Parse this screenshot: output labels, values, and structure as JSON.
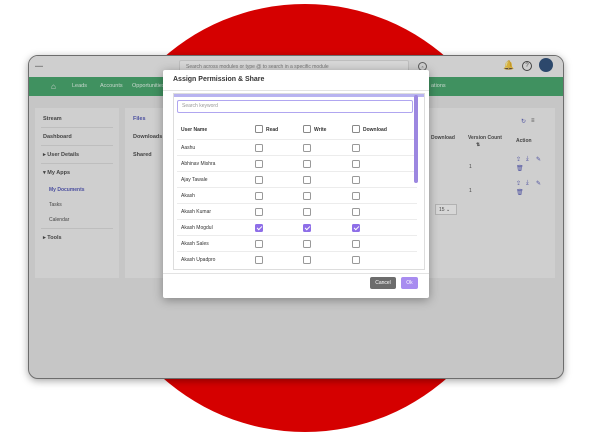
{
  "topbar": {
    "search_placeholder": "Search across modules or type @ to search in a specific module"
  },
  "nav": {
    "links": [
      "Leads",
      "Accounts",
      "Opportunities",
      "ations"
    ]
  },
  "sidebar": {
    "items": [
      "Stream",
      "Dashboard",
      "User Details",
      "My Apps",
      "My Documents",
      "Tasks",
      "Calendar",
      "Tools"
    ]
  },
  "folders": [
    "Files",
    "Downloads",
    "Shared"
  ],
  "main": {
    "headers": [
      "Download",
      "Version Count",
      "Action"
    ],
    "version_counts": [
      "1",
      "1"
    ],
    "page_size": "15"
  },
  "modal": {
    "title": "Assign Permission & Share",
    "search_placeholder": "Search keyword",
    "columns": {
      "user": "User Name",
      "read": "Read",
      "write": "Write",
      "download": "Download"
    },
    "rows": [
      {
        "name": "Aashu",
        "read": false,
        "write": false,
        "download": false
      },
      {
        "name": "Abhinav Mishra",
        "read": false,
        "write": false,
        "download": false
      },
      {
        "name": "Ajay Tawale",
        "read": false,
        "write": false,
        "download": false
      },
      {
        "name": "Akash",
        "read": false,
        "write": false,
        "download": false
      },
      {
        "name": "Akash Kumar",
        "read": false,
        "write": false,
        "download": false
      },
      {
        "name": "Akash Mogdul",
        "read": true,
        "write": true,
        "download": true
      },
      {
        "name": "Akash Sales",
        "read": false,
        "write": false,
        "download": false
      },
      {
        "name": "Akash Upadpro",
        "read": false,
        "write": false,
        "download": false
      }
    ],
    "cancel_label": "Cancel",
    "ok_label": "Ok"
  }
}
